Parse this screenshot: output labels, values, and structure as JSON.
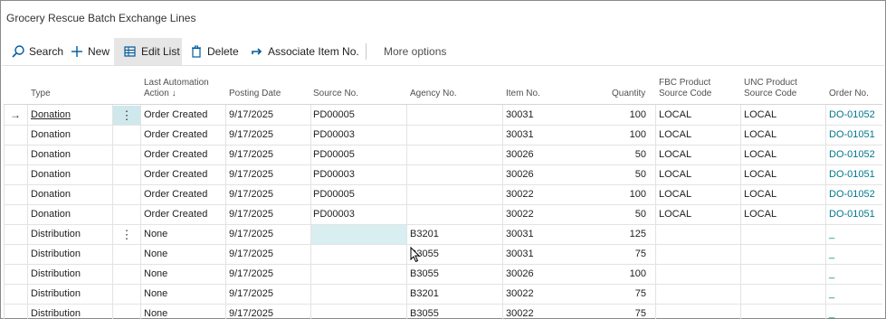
{
  "page": {
    "title": "Grocery Rescue Batch Exchange Lines"
  },
  "actions": {
    "search": "Search",
    "new": "New",
    "edit_list": "Edit List",
    "delete": "Delete",
    "associate": "Associate Item No.",
    "more": "More options"
  },
  "columns": {
    "type": "Type",
    "last_action_line1": "Last Automation",
    "last_action_line2": "Action ↓",
    "posting_date": "Posting Date",
    "source_no": "Source No.",
    "agency_no": "Agency No.",
    "item_no": "Item No.",
    "quantity": "Quantity",
    "fbc_line1": "FBC Product",
    "fbc_line2": "Source Code",
    "unc_line1": "UNC Product",
    "unc_line2": "Source Code",
    "order_no": "Order No."
  },
  "rows": [
    {
      "type": "Donation",
      "action": "Order Created",
      "date": "9/17/2025",
      "source": "PD00005",
      "agency": "",
      "item": "30031",
      "qty": "100",
      "fbc": "LOCAL",
      "unc": "LOCAL",
      "order": "DO-01052"
    },
    {
      "type": "Donation",
      "action": "Order Created",
      "date": "9/17/2025",
      "source": "PD00003",
      "agency": "",
      "item": "30031",
      "qty": "100",
      "fbc": "LOCAL",
      "unc": "LOCAL",
      "order": "DO-01051"
    },
    {
      "type": "Donation",
      "action": "Order Created",
      "date": "9/17/2025",
      "source": "PD00005",
      "agency": "",
      "item": "30026",
      "qty": "50",
      "fbc": "LOCAL",
      "unc": "LOCAL",
      "order": "DO-01052"
    },
    {
      "type": "Donation",
      "action": "Order Created",
      "date": "9/17/2025",
      "source": "PD00003",
      "agency": "",
      "item": "30026",
      "qty": "50",
      "fbc": "LOCAL",
      "unc": "LOCAL",
      "order": "DO-01051"
    },
    {
      "type": "Donation",
      "action": "Order Created",
      "date": "9/17/2025",
      "source": "PD00005",
      "agency": "",
      "item": "30022",
      "qty": "100",
      "fbc": "LOCAL",
      "unc": "LOCAL",
      "order": "DO-01052"
    },
    {
      "type": "Donation",
      "action": "Order Created",
      "date": "9/17/2025",
      "source": "PD00003",
      "agency": "",
      "item": "30022",
      "qty": "50",
      "fbc": "LOCAL",
      "unc": "LOCAL",
      "order": "DO-01051"
    },
    {
      "type": "Distribution",
      "action": "None",
      "date": "9/17/2025",
      "source": "",
      "agency": "B3201",
      "item": "30031",
      "qty": "125",
      "fbc": "",
      "unc": "",
      "order": "_"
    },
    {
      "type": "Distribution",
      "action": "None",
      "date": "9/17/2025",
      "source": "",
      "agency": "B3055",
      "item": "30031",
      "qty": "75",
      "fbc": "",
      "unc": "",
      "order": "_"
    },
    {
      "type": "Distribution",
      "action": "None",
      "date": "9/17/2025",
      "source": "",
      "agency": "B3055",
      "item": "30026",
      "qty": "100",
      "fbc": "",
      "unc": "",
      "order": "_"
    },
    {
      "type": "Distribution",
      "action": "None",
      "date": "9/17/2025",
      "source": "",
      "agency": "B3201",
      "item": "30022",
      "qty": "75",
      "fbc": "",
      "unc": "",
      "order": "_"
    },
    {
      "type": "Distribution",
      "action": "None",
      "date": "9/17/2025",
      "source": "",
      "agency": "B3055",
      "item": "30022",
      "qty": "75",
      "fbc": "",
      "unc": "",
      "order": "_"
    }
  ]
}
